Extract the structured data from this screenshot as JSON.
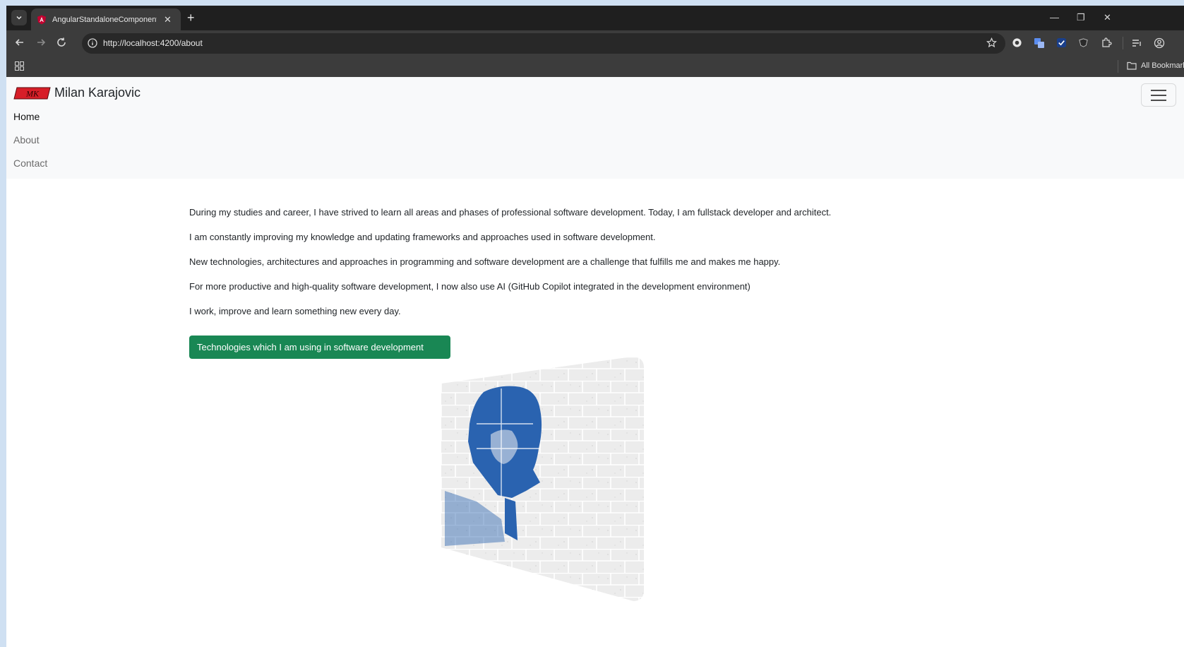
{
  "browser": {
    "tab_title": "AngularStandaloneComponents",
    "url": "http://localhost:4200/about",
    "bookmarks_label": "All Bookmarks"
  },
  "site": {
    "brand_name": "Milan Karajovic",
    "logo_text": "MK",
    "nav": [
      "Home",
      "About",
      "Contact"
    ],
    "paragraphs": [
      "During my studies and career, I have strived to learn all areas and phases of professional software development. Today, I am fullstack developer and architect.",
      "I am constantly improving my knowledge and updating frameworks and approaches used in software development.",
      "New technologies, architectures and approaches in programming and software development are a challenge that fulfills me and makes me happy.",
      "For more productive and high-quality software development, I now also use AI (GitHub Copilot integrated in the development environment)",
      "I work, improve and learn something new every day."
    ],
    "tech_button": "Technologies which I am using in software development",
    "accent_color": "#198754",
    "portrait_color": "#2a63b0"
  }
}
